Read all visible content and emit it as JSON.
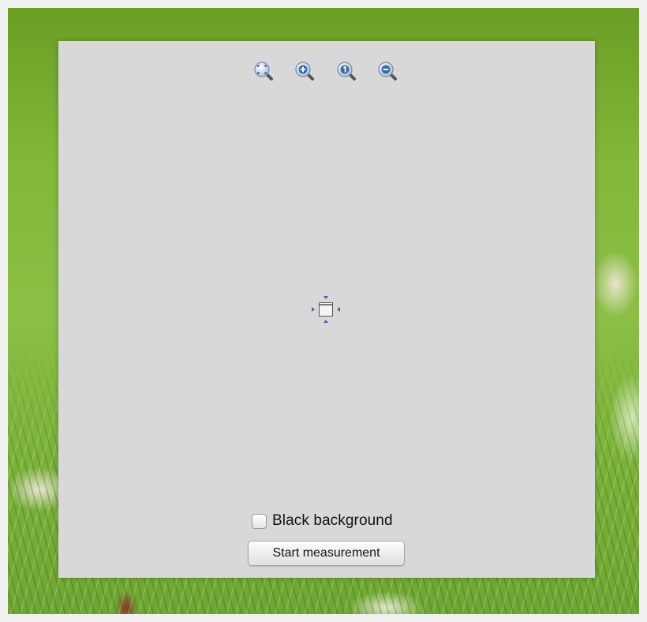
{
  "zoom_toolbar": {
    "buttons": [
      {
        "icon": "zoom-fit-icon"
      },
      {
        "icon": "zoom-in-icon"
      },
      {
        "icon": "zoom-actual-size-icon"
      },
      {
        "icon": "zoom-out-icon"
      }
    ]
  },
  "viewer": {
    "center_icon": "center-target-icon"
  },
  "options": {
    "black_background_label": "Black background",
    "black_background_checked": false
  },
  "actions": {
    "start_measurement_label": "Start measurement"
  },
  "colors": {
    "panel_background": "#d8d8d8",
    "icon_blue": "#3b6aa8",
    "wallpaper_green": "#82b73a"
  }
}
